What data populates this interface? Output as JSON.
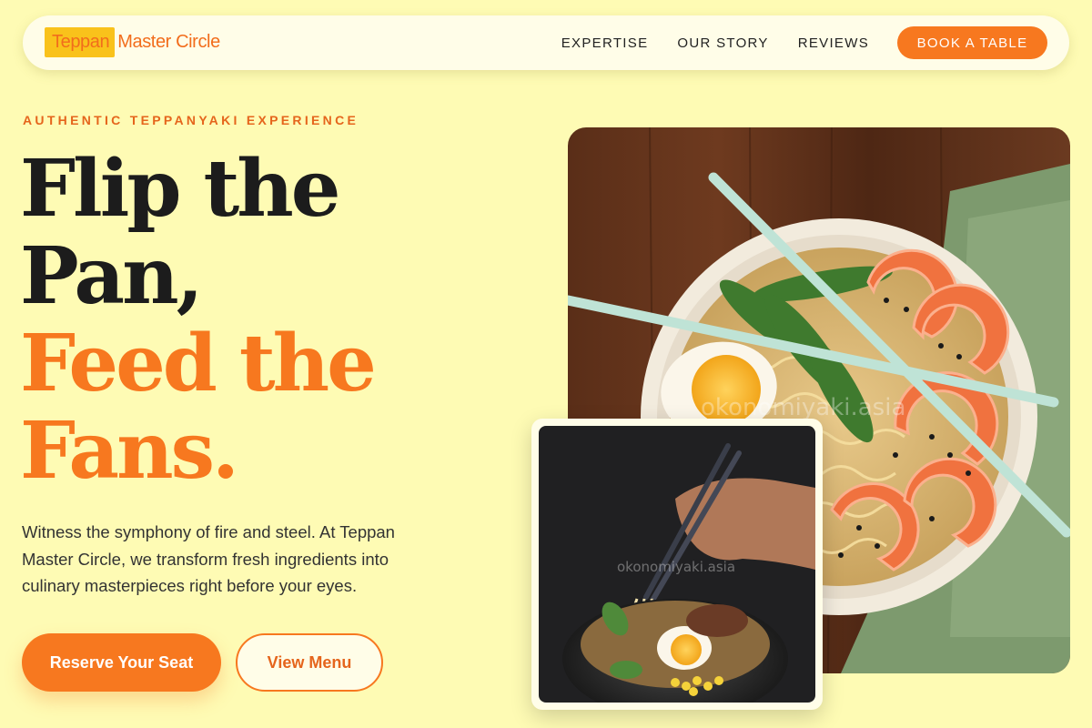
{
  "brand": {
    "part1": "Teppan",
    "part2": "Master Circle"
  },
  "nav": {
    "links": [
      "EXPERTISE",
      "OUR STORY",
      "REVIEWS"
    ],
    "cta": "BOOK A TABLE"
  },
  "hero": {
    "eyebrow": "AUTHENTIC TEPPANYAKI EXPERIENCE",
    "headline": {
      "line1": "Flip the",
      "line2": "Pan,",
      "line3": "Feed the",
      "line4": "Fans."
    },
    "lead": "Witness the symphony of fire and steel. At Teppan Master Circle, we transform fresh ingredients into culinary masterpieces right before your eyes.",
    "primary_button": "Reserve Your Seat",
    "secondary_button": "View Menu"
  },
  "images": {
    "main_watermark": "okonomiyaki.asia",
    "small_watermark": "okonomiyaki.asia"
  },
  "colors": {
    "background": "#fefbb4",
    "accent": "#f7781f",
    "logo_highlight": "#f9c21b",
    "text_dark": "#1c1c1c"
  }
}
